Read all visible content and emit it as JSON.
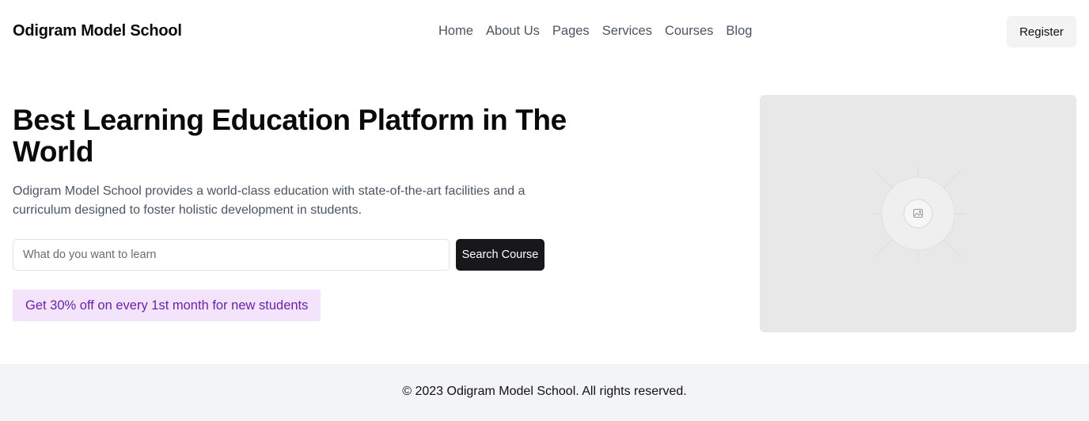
{
  "header": {
    "brand": "Odigram Model School",
    "nav": [
      "Home",
      "About Us",
      "Pages",
      "Services",
      "Courses",
      "Blog"
    ],
    "register_label": "Register"
  },
  "hero": {
    "title": "Best Learning Education Platform in The World",
    "description": "Odigram Model School provides a world-class education with state-of-the-art facilities and a curriculum designed to foster holistic development in students.",
    "search": {
      "placeholder": "What do you want to learn",
      "value": "",
      "button_label": "Search Course"
    },
    "promo": "Get 30% off on every 1st month for new students",
    "image_icon": "image-placeholder-icon"
  },
  "footer": {
    "copyright": "© 2023 Odigram Model School. All rights reserved."
  },
  "colors": {
    "primary_button": "#18181b",
    "promo_background": "#f3e4fc",
    "promo_text": "#6b21a8",
    "footer_background": "#f3f4f6",
    "image_placeholder": "#e8e8e8"
  }
}
